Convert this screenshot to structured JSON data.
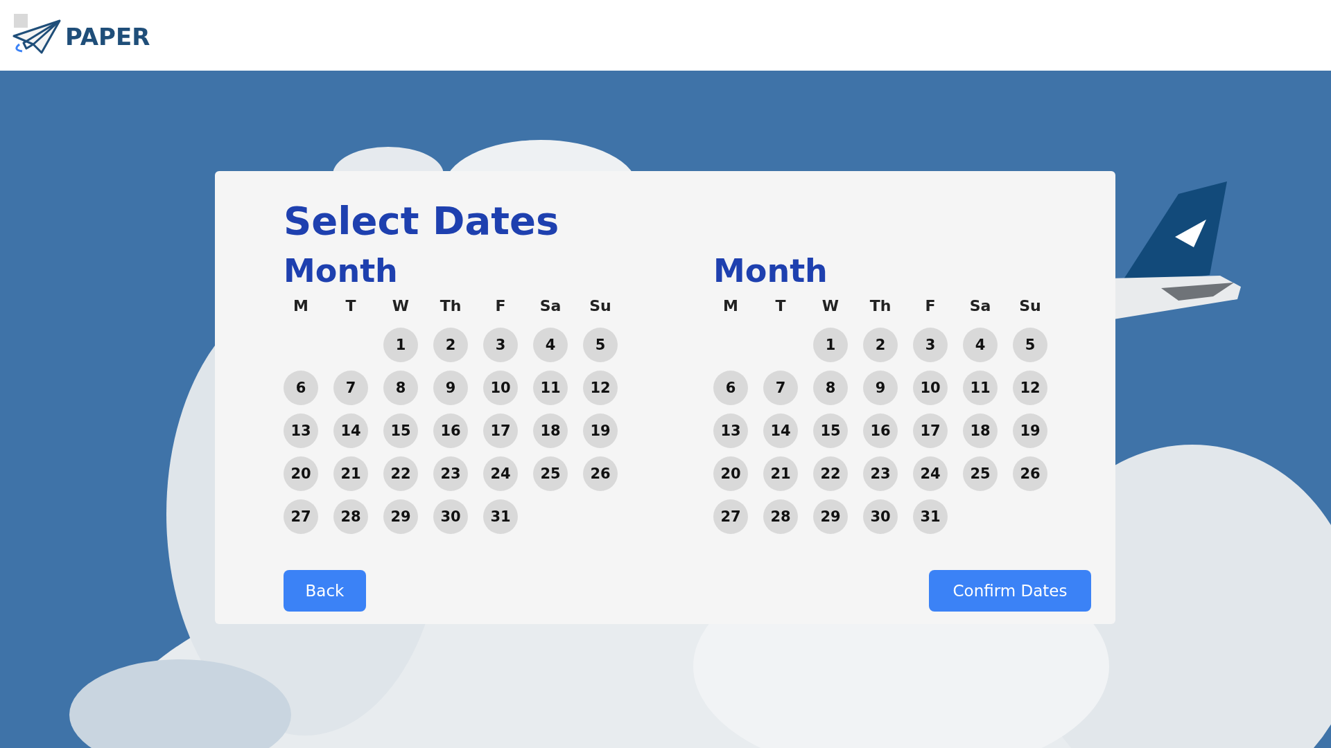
{
  "header": {
    "brand": "PAPER"
  },
  "card": {
    "title": "Select Dates",
    "calendars": [
      {
        "title": "Month",
        "weekdays": [
          "M",
          "T",
          "W",
          "Th",
          "F",
          "Sa",
          "Su"
        ],
        "weeks": [
          [
            {
              "kind": "blank"
            },
            {
              "kind": "blank"
            },
            {
              "kind": "day",
              "label": "1"
            },
            {
              "kind": "day",
              "label": "2"
            },
            {
              "kind": "day",
              "label": "3"
            },
            {
              "kind": "day",
              "label": "4"
            },
            {
              "kind": "day",
              "label": "5"
            }
          ],
          [
            {
              "kind": "day",
              "label": "6"
            },
            {
              "kind": "day",
              "label": "7"
            },
            {
              "kind": "day",
              "label": "8"
            },
            {
              "kind": "day",
              "label": "9"
            },
            {
              "kind": "day",
              "label": "10"
            },
            {
              "kind": "day",
              "label": "11"
            },
            {
              "kind": "day",
              "label": "12"
            }
          ],
          [
            {
              "kind": "day",
              "label": "13"
            },
            {
              "kind": "day",
              "label": "14"
            },
            {
              "kind": "day",
              "label": "15"
            },
            {
              "kind": "day",
              "label": "16"
            },
            {
              "kind": "day",
              "label": "17"
            },
            {
              "kind": "day",
              "label": "18"
            },
            {
              "kind": "day",
              "label": "19"
            }
          ],
          [
            {
              "kind": "day",
              "label": "20"
            },
            {
              "kind": "day",
              "label": "21"
            },
            {
              "kind": "day",
              "label": "22"
            },
            {
              "kind": "day",
              "label": "23"
            },
            {
              "kind": "day",
              "label": "24"
            },
            {
              "kind": "day",
              "label": "25"
            },
            {
              "kind": "day",
              "label": "26"
            }
          ],
          [
            {
              "kind": "day",
              "label": "27"
            },
            {
              "kind": "day",
              "label": "28"
            },
            {
              "kind": "day",
              "label": "29"
            },
            {
              "kind": "day",
              "label": "30"
            },
            {
              "kind": "day",
              "label": "31"
            },
            {
              "kind": "blank"
            },
            {
              "kind": "blank"
            }
          ]
        ]
      },
      {
        "title": "Month",
        "weekdays": [
          "M",
          "T",
          "W",
          "Th",
          "F",
          "Sa",
          "Su"
        ],
        "weeks": [
          [
            {
              "kind": "blank"
            },
            {
              "kind": "blank"
            },
            {
              "kind": "day",
              "label": "1"
            },
            {
              "kind": "day",
              "label": "2"
            },
            {
              "kind": "day",
              "label": "3"
            },
            {
              "kind": "day",
              "label": "4"
            },
            {
              "kind": "day",
              "label": "5"
            }
          ],
          [
            {
              "kind": "day",
              "label": "6"
            },
            {
              "kind": "day",
              "label": "7"
            },
            {
              "kind": "day",
              "label": "8"
            },
            {
              "kind": "day",
              "label": "9"
            },
            {
              "kind": "day",
              "label": "10"
            },
            {
              "kind": "day",
              "label": "11"
            },
            {
              "kind": "day",
              "label": "12"
            }
          ],
          [
            {
              "kind": "day",
              "label": "13"
            },
            {
              "kind": "day",
              "label": "14"
            },
            {
              "kind": "day",
              "label": "15"
            },
            {
              "kind": "day",
              "label": "16"
            },
            {
              "kind": "day",
              "label": "17"
            },
            {
              "kind": "day",
              "label": "18"
            },
            {
              "kind": "day",
              "label": "19"
            }
          ],
          [
            {
              "kind": "day",
              "label": "20"
            },
            {
              "kind": "day",
              "label": "21"
            },
            {
              "kind": "day",
              "label": "22"
            },
            {
              "kind": "day",
              "label": "23"
            },
            {
              "kind": "day",
              "label": "24"
            },
            {
              "kind": "day",
              "label": "25"
            },
            {
              "kind": "day",
              "label": "26"
            }
          ],
          [
            {
              "kind": "day",
              "label": "27"
            },
            {
              "kind": "day",
              "label": "28"
            },
            {
              "kind": "day",
              "label": "29"
            },
            {
              "kind": "day",
              "label": "30"
            },
            {
              "kind": "day",
              "label": "31"
            },
            {
              "kind": "blank"
            },
            {
              "kind": "blank"
            }
          ]
        ]
      }
    ],
    "buttons": [
      {
        "label": "Back",
        "kind": "back"
      },
      {
        "label": "Confirm Dates",
        "kind": "confirm"
      }
    ]
  }
}
